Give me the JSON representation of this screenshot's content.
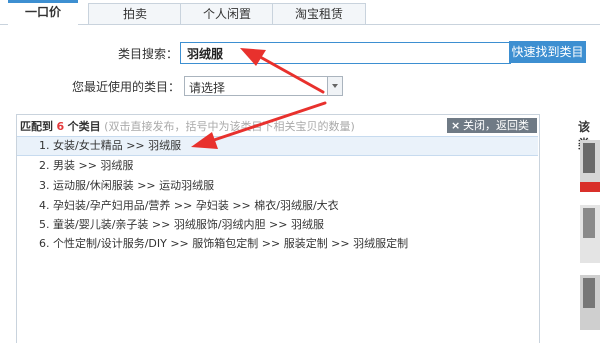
{
  "tabs": [
    {
      "label": "一口价"
    },
    {
      "label": "拍卖"
    },
    {
      "label": "个人闲置"
    },
    {
      "label": "淘宝租赁"
    }
  ],
  "form": {
    "category_search_label": "类目搜索：",
    "category_search_value": "羽绒服",
    "search_button": "快速找到类目",
    "recent_label": "您最近使用的类目：",
    "recent_select_value": "请选择"
  },
  "results": {
    "prefix": "匹配到",
    "count": "6",
    "suffix": "个类目",
    "hint": "(双击直接发布，括号中为该类目下相关宝贝的数量)",
    "close_label": "关闭，返回类目",
    "items": [
      "1.  女装/女士精品 >> 羽绒服",
      "2.  男装 >> 羽绒服",
      "3.  运动服/休闲服装 >> 运动羽绒服",
      "4.  孕妇装/孕产妇用品/营养 >> 孕妇装 >> 棉衣/羽绒服/大衣",
      "5.  童装/婴儿装/亲子装 >> 羽绒服饰/羽绒内胆 >> 羽绒服",
      "6.  个性定制/设计服务/DIY >> 服饰箱包定制 >> 服装定制 >> 羽绒服定制"
    ]
  },
  "sidebar": {
    "title": "该类"
  },
  "colors": {
    "accent": "#3d8fd1",
    "count": "#e4393c",
    "annotation_arrow": "#e8312d"
  }
}
